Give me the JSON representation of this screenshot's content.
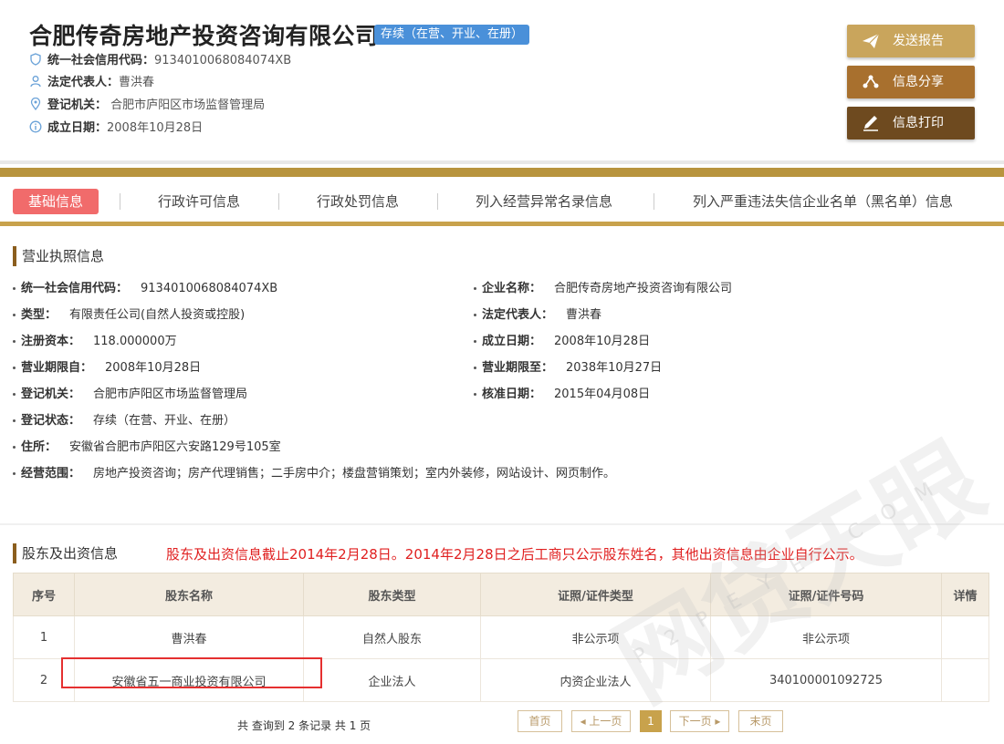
{
  "header": {
    "company_name": "合肥传奇房地产投资咨询有限公司",
    "status_badge": "存续（在营、开业、在册）",
    "credit_code_label": "统一社会信用代码：",
    "credit_code": "9134010068084074XB",
    "legal_rep_label": "法定代表人：",
    "legal_rep": "曹洪春",
    "reg_authority_label": "登记机关：",
    "reg_authority": "合肥市庐阳区市场监督管理局",
    "founded_label": "成立日期：",
    "founded": "2008年10月28日"
  },
  "actions": {
    "send_report": "发送报告",
    "share": "信息分享",
    "print": "信息打印"
  },
  "tabs": [
    "基础信息",
    "行政许可信息",
    "行政处罚信息",
    "列入经营异常名录信息",
    "列入严重违法失信企业名单（黑名单）信息"
  ],
  "license": {
    "title": "营业执照信息",
    "left": [
      {
        "label": "统一社会信用代码：",
        "value": "9134010068084074XB"
      },
      {
        "label": "类型：",
        "value": "有限责任公司(自然人投资或控股)"
      },
      {
        "label": "注册资本：",
        "value": "118.000000万"
      },
      {
        "label": "营业期限自：",
        "value": "2008年10月28日"
      },
      {
        "label": "登记机关：",
        "value": "合肥市庐阳区市场监督管理局"
      },
      {
        "label": "登记状态：",
        "value": "存续（在营、开业、在册）"
      },
      {
        "label": "住所：",
        "value": "安徽省合肥市庐阳区六安路129号105室"
      },
      {
        "label": "经营范围：",
        "value": "房地产投资咨询；房产代理销售；二手房中介；楼盘营销策划；室内外装修，网站设计、网页制作。"
      }
    ],
    "right": [
      {
        "label": "企业名称：",
        "value": "合肥传奇房地产投资咨询有限公司"
      },
      {
        "label": "法定代表人：",
        "value": "曹洪春"
      },
      {
        "label": "成立日期：",
        "value": "2008年10月28日"
      },
      {
        "label": "营业期限至：",
        "value": "2038年10月27日"
      },
      {
        "label": "核准日期：",
        "value": "2015年04月08日"
      }
    ]
  },
  "shareholders": {
    "title": "股东及出资信息",
    "notice": "股东及出资信息截止2014年2月28日。2014年2月28日之后工商只公示股东姓名，其他出资信息由企业自行公示。",
    "columns": [
      "序号",
      "股东名称",
      "股东类型",
      "证照/证件类型",
      "证照/证件号码",
      "详情"
    ],
    "rows": [
      [
        "1",
        "曹洪春",
        "自然人股东",
        "非公示项",
        "非公示项",
        ""
      ],
      [
        "2",
        "安徽省五一商业投资有限公司",
        "企业法人",
        "内资企业法人",
        "340100001092725",
        ""
      ]
    ]
  },
  "pager": {
    "summary": "共 查询到 2 条记录 共 1 页",
    "first": "首页",
    "prev": "◂ 上一页",
    "current": "1",
    "next": "下一页 ▸",
    "last": "末页"
  },
  "watermark": {
    "brand": "网贷天眼",
    "site": "P2PEYE.COM"
  },
  "colors": {
    "gold": "#b8943e",
    "active_tab": "#f16b6b",
    "badge": "#4a90d9",
    "notice": "#e02020"
  }
}
